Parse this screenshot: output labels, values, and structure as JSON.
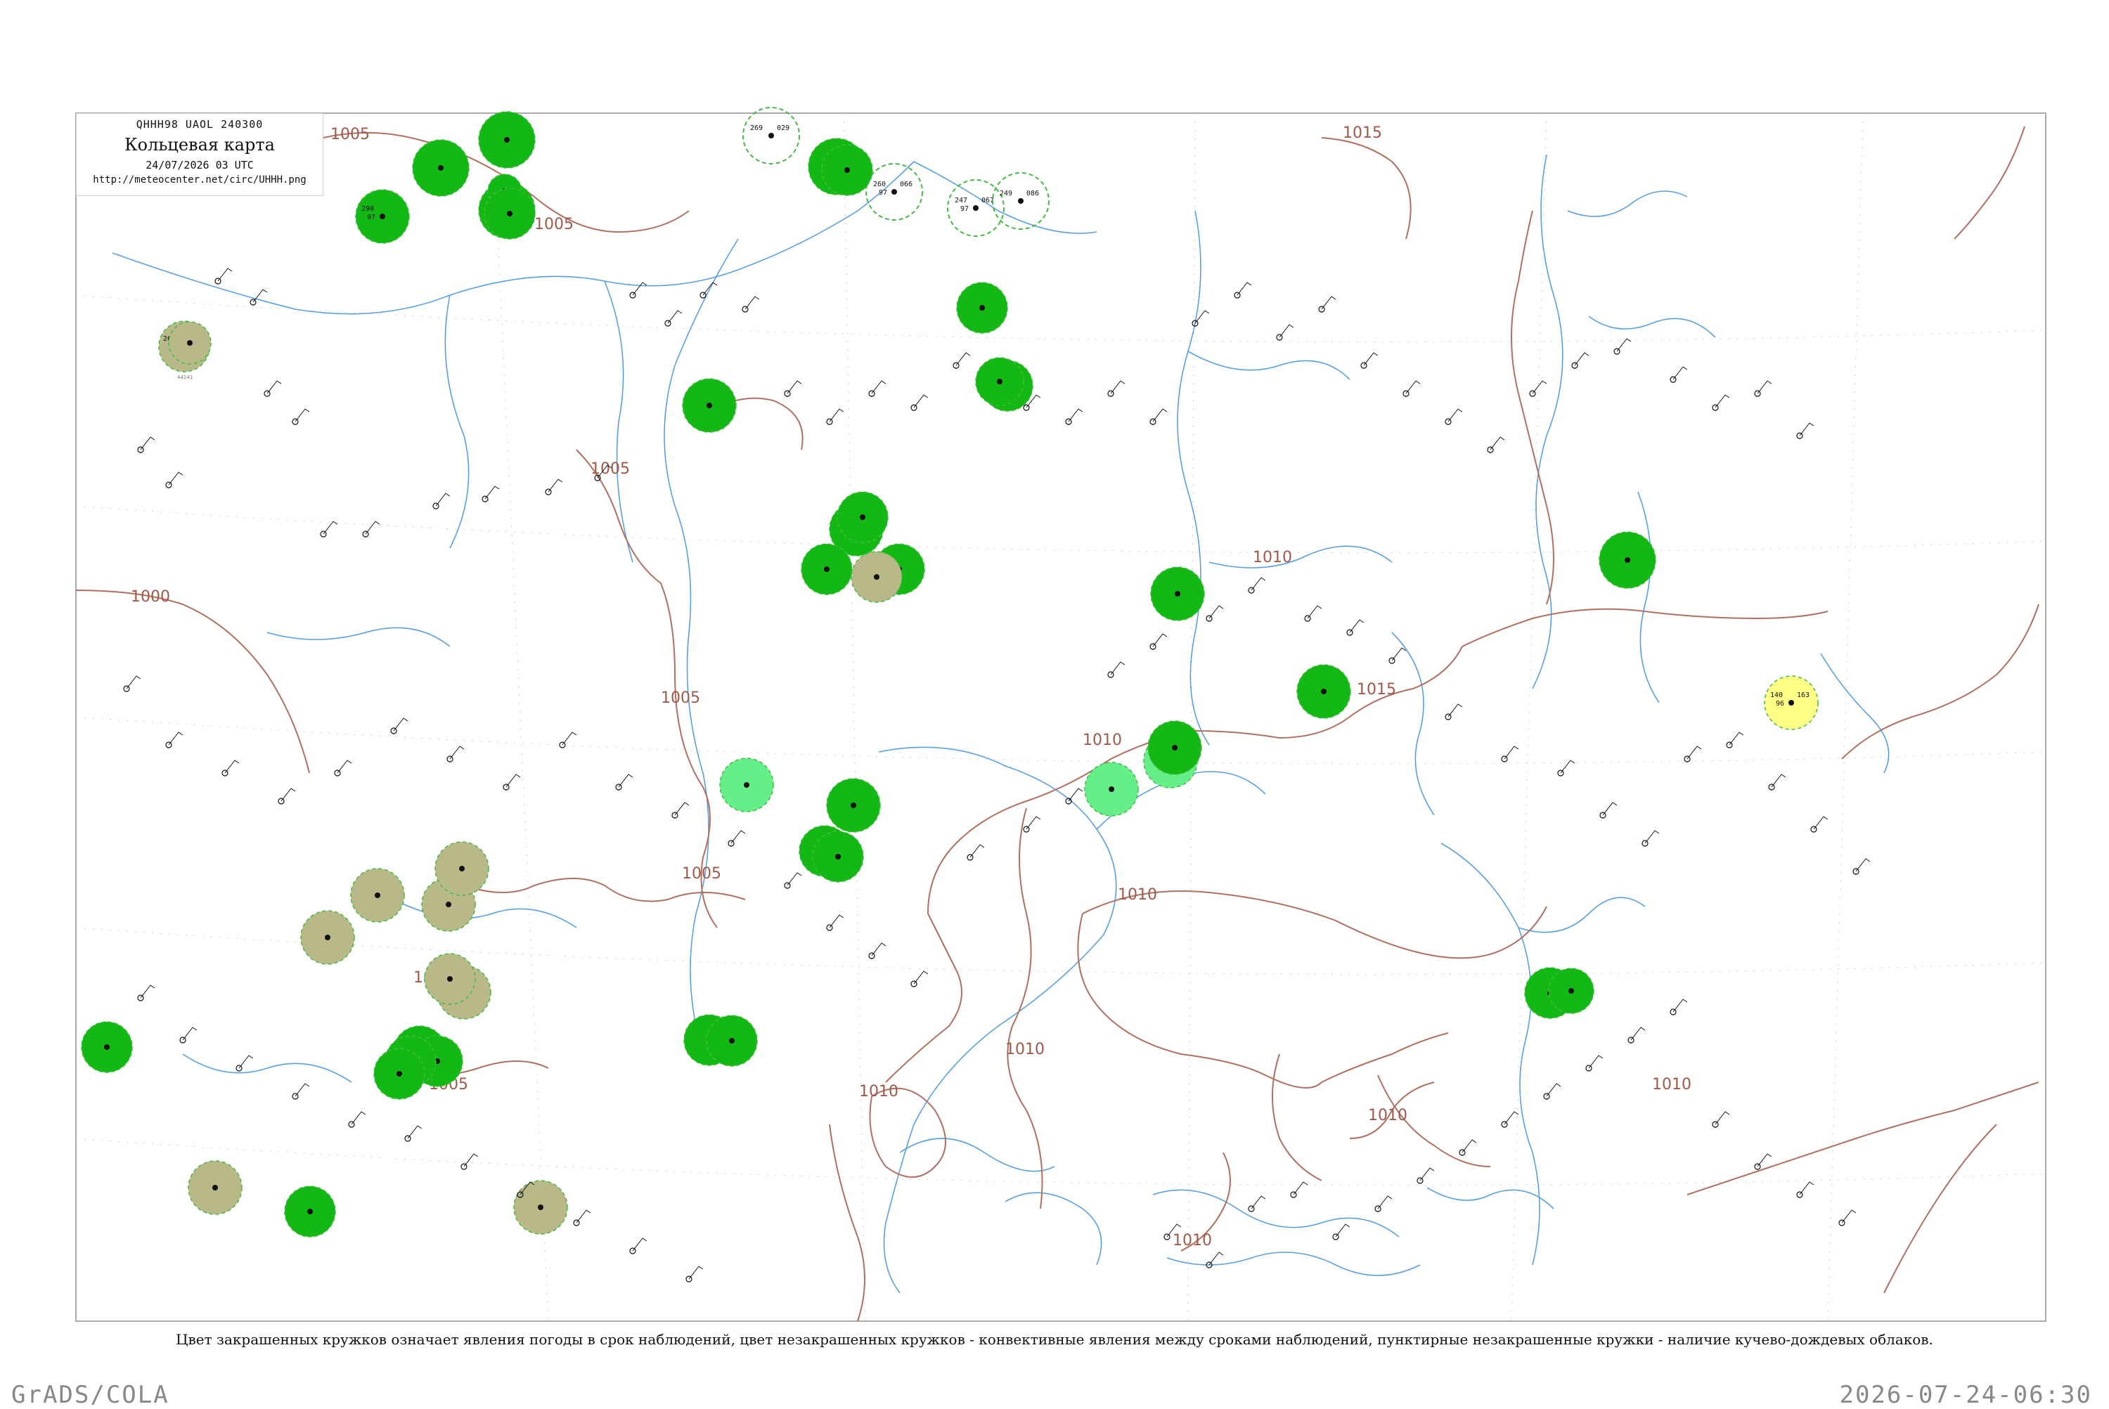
{
  "header": {
    "code": "QHHH98  UAOL  240300",
    "title": "Кольцевая карта",
    "date": "24/07/2026 03 UTC",
    "url": "http://meteocenter.net/circ/UHHH.png"
  },
  "caption": "Цвет закрашенных кружков означает явления погоды в срок наблюдений, цвет незакрашенных кружков - конвективные явления между сроками наблюдений, пунктирные незакрашенные кружки - наличие кучево-дождевых облаков.",
  "footer": {
    "left": "GrADS/COLA",
    "right": "2026-07-24-06:30"
  },
  "colors": {
    "isobar": "#b07060",
    "river": "#5aa0e0",
    "frame": "#aaaaaa",
    "rain_dark": "#14b814",
    "rain_light": "#66ee88",
    "haze": "#b8b888",
    "thunder_yellow": "#ffff88",
    "cb_dashed": "#44bb44"
  },
  "isobar_labels": [
    "1005",
    "1015",
    "1005",
    "1000",
    "1005",
    "1005",
    "1005",
    "1005",
    "1010",
    "1010",
    "1010",
    "1010",
    "1015",
    "1010",
    "1010",
    "1010",
    "1010",
    "1005"
  ],
  "stations": [
    {
      "t": "267",
      "p": "97",
      "d": "020",
      "id": "44241",
      "fill": "haze"
    },
    {
      "t": "290",
      "p": "97",
      "d": "",
      "id": "",
      "fill": "rain_dark"
    },
    {
      "t": "",
      "p": "",
      "d": "",
      "id": "",
      "fill": "rain_dark"
    },
    {
      "t": "",
      "p": "",
      "d": "",
      "id": "",
      "fill": "rain_dark"
    },
    {
      "t": "",
      "p": "",
      "d": "",
      "id": "",
      "fill": "rain_dark"
    },
    {
      "t": "",
      "p": "",
      "d": "",
      "id": "",
      "fill": "rain_dark"
    },
    {
      "t": "269",
      "p": "",
      "d": "029",
      "id": "",
      "fill": "cb"
    },
    {
      "t": "",
      "p": "",
      "d": "",
      "id": "",
      "fill": "rain_dark"
    },
    {
      "t": "260",
      "p": "97",
      "d": "066",
      "id": "",
      "fill": "cb"
    },
    {
      "t": "247",
      "p": "97",
      "d": "067",
      "id": "",
      "fill": "cb"
    },
    {
      "t": "249",
      "p": "",
      "d": "086",
      "id": "",
      "fill": "cb"
    },
    {
      "t": "",
      "p": "",
      "d": "",
      "id": "",
      "fill": "rain_dark"
    },
    {
      "t": "",
      "p": "",
      "d": "",
      "id": "",
      "fill": "rain_dark"
    },
    {
      "t": "",
      "p": "",
      "d": "",
      "id": "",
      "fill": "rain_dark"
    },
    {
      "t": "",
      "p": "",
      "d": "",
      "id": "",
      "fill": "rain_dark"
    },
    {
      "t": "",
      "p": "",
      "d": "",
      "id": "",
      "fill": "rain_dark"
    },
    {
      "t": "",
      "p": "",
      "d": "",
      "id": "",
      "fill": "rain_dark"
    },
    {
      "t": "",
      "p": "",
      "d": "",
      "id": "",
      "fill": "rain_dark"
    },
    {
      "t": "",
      "p": "",
      "d": "",
      "id": "",
      "fill": "rain_dark"
    },
    {
      "t": "",
      "p": "",
      "d": "",
      "id": "",
      "fill": "rain_dark"
    },
    {
      "t": "",
      "p": "",
      "d": "",
      "id": "",
      "fill": "rain_dark"
    },
    {
      "t": "",
      "p": "",
      "d": "",
      "id": "",
      "fill": "rain_dark"
    },
    {
      "t": "",
      "p": "",
      "d": "",
      "id": "",
      "fill": "rain_light"
    },
    {
      "t": "",
      "p": "",
      "d": "",
      "id": "",
      "fill": "rain_light"
    },
    {
      "t": "",
      "p": "",
      "d": "",
      "id": "",
      "fill": "rain_light"
    },
    {
      "t": "",
      "p": "",
      "d": "",
      "id": "",
      "fill": "rain_dark"
    },
    {
      "t": "",
      "p": "",
      "d": "",
      "id": "",
      "fill": "rain_dark"
    },
    {
      "t": "",
      "p": "",
      "d": "",
      "id": "",
      "fill": "rain_dark"
    },
    {
      "t": "",
      "p": "",
      "d": "",
      "id": "",
      "fill": "rain_dark"
    },
    {
      "t": "",
      "p": "",
      "d": "",
      "id": "",
      "fill": "rain_dark"
    },
    {
      "t": "",
      "p": "",
      "d": "",
      "id": "",
      "fill": "rain_dark"
    },
    {
      "t": "",
      "p": "",
      "d": "",
      "id": "",
      "fill": "rain_dark"
    },
    {
      "t": "",
      "p": "",
      "d": "",
      "id": "",
      "fill": "rain_dark"
    },
    {
      "t": "",
      "p": "",
      "d": "",
      "id": "",
      "fill": "rain_dark"
    },
    {
      "t": "",
      "p": "",
      "d": "",
      "id": "",
      "fill": "rain_dark"
    },
    {
      "t": "",
      "p": "",
      "d": "",
      "id": "",
      "fill": "haze"
    },
    {
      "t": "",
      "p": "",
      "d": "",
      "id": "",
      "fill": "haze"
    },
    {
      "t": "",
      "p": "",
      "d": "",
      "id": "",
      "fill": "haze"
    },
    {
      "t": "",
      "p": "",
      "d": "",
      "id": "",
      "fill": "haze"
    },
    {
      "t": "",
      "p": "",
      "d": "",
      "id": "",
      "fill": "haze"
    },
    {
      "t": "",
      "p": "",
      "d": "",
      "id": "",
      "fill": "haze"
    },
    {
      "t": "",
      "p": "",
      "d": "",
      "id": "",
      "fill": "haze"
    },
    {
      "t": "",
      "p": "",
      "d": "",
      "id": "",
      "fill": "haze"
    },
    {
      "t": "",
      "p": "",
      "d": "",
      "id": "",
      "fill": "haze"
    },
    {
      "t": "",
      "p": "",
      "d": "",
      "id": "",
      "fill": "haze"
    },
    {
      "t": "",
      "p": "",
      "d": "",
      "id": "",
      "fill": "rain_dark"
    },
    {
      "t": "",
      "p": "",
      "d": "",
      "id": "",
      "fill": "rain_dark"
    },
    {
      "t": "",
      "p": "",
      "d": "",
      "id": "",
      "fill": "rain_dark"
    },
    {
      "t": "",
      "p": "",
      "d": "",
      "id": "",
      "fill": "rain_dark"
    },
    {
      "t": "",
      "p": "",
      "d": "",
      "id": "",
      "fill": "rain_dark"
    },
    {
      "t": "",
      "p": "",
      "d": "",
      "id": "",
      "fill": "rain_dark"
    },
    {
      "t": "140",
      "p": "96",
      "d": "163",
      "id": "",
      "fill": "thunder_yellow"
    }
  ]
}
